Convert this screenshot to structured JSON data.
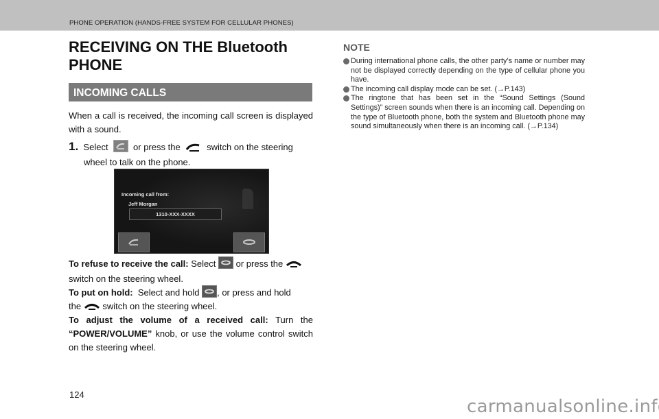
{
  "header": {
    "running_title": "PHONE OPERATION (HANDS-FREE SYSTEM FOR CELLULAR PHONES)"
  },
  "page_title": {
    "line1": "RECEIVING ON THE Bluetooth",
    "line2": "PHONE"
  },
  "section": {
    "title": "INCOMING CALLS"
  },
  "intro": "When a call is received, the incoming call screen is displayed with a sound.",
  "step1": {
    "number": "1.",
    "select_word": "Select",
    "text_mid": "or press the",
    "text_end": "switch on the steering",
    "line2": "wheel to talk on the phone."
  },
  "screen": {
    "caption": "Incoming call from:",
    "caller_name": "Jeff Morgan",
    "number": "1310-XXX-XXXX",
    "answer_icon": "phone-answer-icon",
    "hangup_icon": "phone-hangup-icon"
  },
  "refuse": {
    "lead": "To refuse to receive the call:",
    "select_word": "Select",
    "mid": "or press the",
    "end": "switch on the steering wheel."
  },
  "hold": {
    "lead": "To put on hold:",
    "text1": "Select and hold",
    "text2": ", or press and hold",
    "text3": "the",
    "text4": "switch on the steering wheel."
  },
  "volume": {
    "lead": "To adjust the volume of a received call:",
    "text1": "Turn the",
    "knob": "“POWER/VOLUME”",
    "text2": "knob, or use the volume control switch on the steering wheel."
  },
  "note": {
    "title": "NOTE",
    "items": [
      "During international phone calls, the other party’s name or number may not be displayed correctly depending on the type of cellular phone you have.",
      "The incoming call display mode can be set. (→P.143)",
      "The ringtone that has been set in the “Sound Settings (Sound Settings)” screen sounds when there is an incoming call. Depending on the type of Bluetooth phone, both the system and Bluetooth phone may sound simultaneously when there is an incoming call. (→P.134)"
    ]
  },
  "footer": {
    "page_number": "124",
    "watermark": "carmanualsonline.info"
  }
}
